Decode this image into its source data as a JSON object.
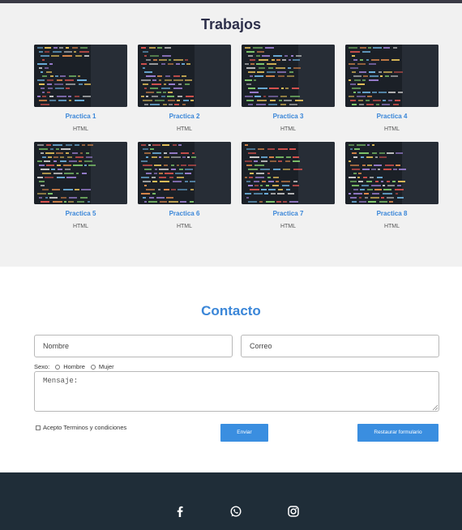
{
  "works": {
    "title": "Trabajos",
    "items": [
      {
        "title": "Practica 1",
        "subtitle": "HTML"
      },
      {
        "title": "Practica 2",
        "subtitle": "HTML"
      },
      {
        "title": "Practica 3",
        "subtitle": "HTML"
      },
      {
        "title": "Practica 4",
        "subtitle": "HTML"
      },
      {
        "title": "Practica 5",
        "subtitle": "HTML"
      },
      {
        "title": "Practica 6",
        "subtitle": "HTML"
      },
      {
        "title": "Practica 7",
        "subtitle": "HTML"
      },
      {
        "title": "Practica 8",
        "subtitle": "HTML"
      }
    ]
  },
  "contact": {
    "title": "Contacto",
    "name_placeholder": "Nombre",
    "email_placeholder": "Correo",
    "sexo_label": "Sexo:",
    "hombre_label": "Hombre",
    "mujer_label": "Mujer",
    "message_placeholder": "Mensaje:",
    "terms_label": "Acepto Terminos y condiciones",
    "submit_label": "Enviar",
    "reset_label": "Restaurar formulario"
  },
  "footer": {
    "icons": [
      "facebook-icon",
      "whatsapp-icon",
      "instagram-icon"
    ]
  },
  "colors": {
    "accent": "#3a86d8",
    "footer_bg": "#1f2d38",
    "section_bg": "#f1f1f1"
  }
}
